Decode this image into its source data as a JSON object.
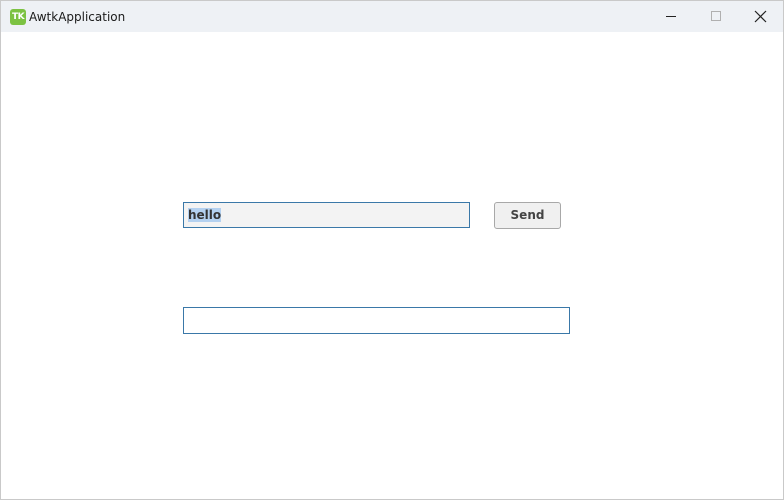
{
  "window": {
    "title": "AwtkApplication",
    "icon_text": "TK",
    "icon_color": "#7cc242"
  },
  "titlebar_buttons": {
    "minimize_icon": "minimize-icon",
    "maximize_icon": "maximize-icon",
    "close_icon": "close-icon"
  },
  "form": {
    "message_value": "hello",
    "send_label": "Send",
    "output_value": ""
  },
  "colors": {
    "focus_border": "#3a78a8",
    "selection": "#b4d1f0"
  }
}
